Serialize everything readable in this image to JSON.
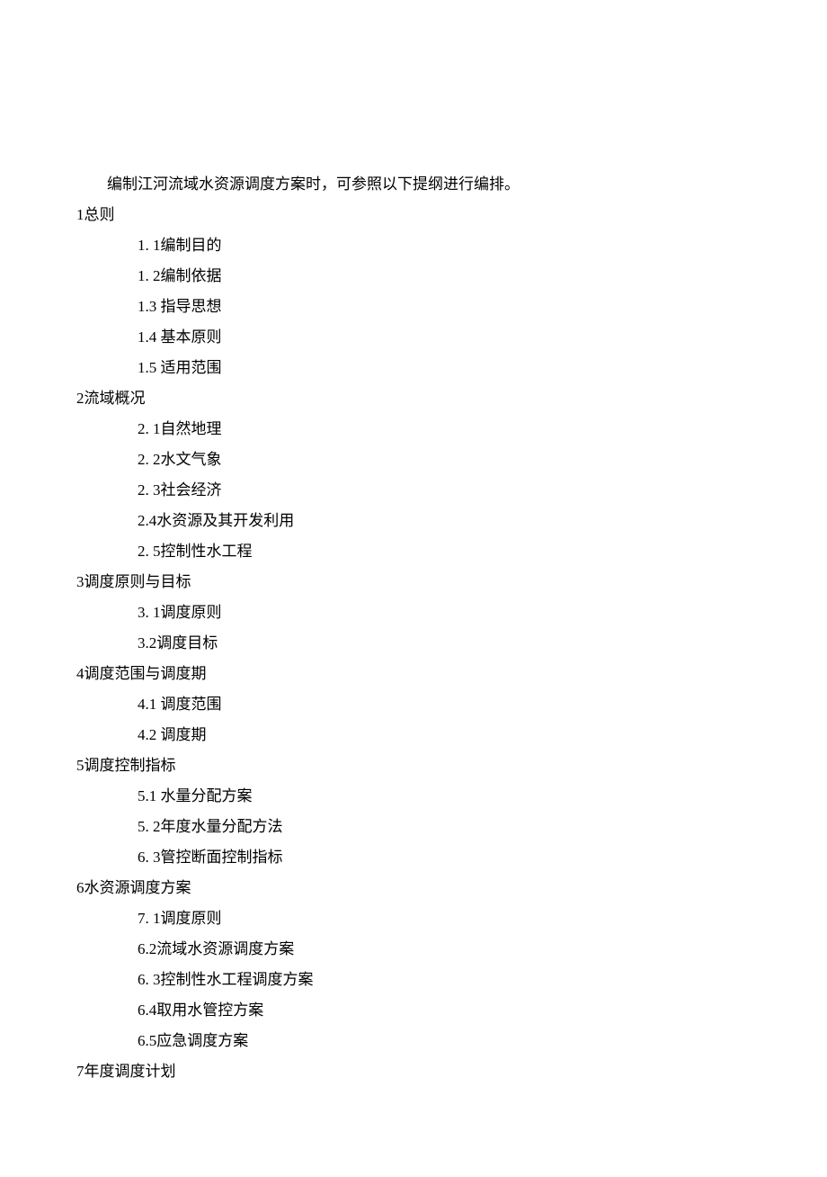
{
  "intro": "编制江河流域水资源调度方案时，可参照以下提纲进行编排。",
  "sections": [
    {
      "heading": "1总则",
      "items": [
        "1.   1编制目的",
        "1.   2编制依据",
        "1.3    指导思想",
        "1.4    基本原则",
        "1.5    适用范围"
      ]
    },
    {
      "heading": "2流域概况",
      "items": [
        "2.   1自然地理",
        "2.   2水文气象",
        "2.   3社会经济",
        "2.4水资源及其开发利用",
        "2.   5控制性水工程"
      ]
    },
    {
      "heading": "3调度原则与目标",
      "items": [
        "3.   1调度原则",
        "3.2调度目标"
      ]
    },
    {
      "heading": "4调度范围与调度期",
      "items": [
        "4.1    调度范围",
        "4.2    调度期"
      ]
    },
    {
      "heading": "5调度控制指标",
      "items": [
        "5.1    水量分配方案",
        "5.   2年度水量分配方法",
        "6.   3管控断面控制指标"
      ]
    },
    {
      "heading": "6水资源调度方案",
      "items": [
        "7.   1调度原则",
        "6.2流域水资源调度方案",
        "6.   3控制性水工程调度方案",
        "6.4取用水管控方案",
        "6.5应急调度方案"
      ]
    },
    {
      "heading": "7年度调度计划",
      "items": []
    }
  ]
}
